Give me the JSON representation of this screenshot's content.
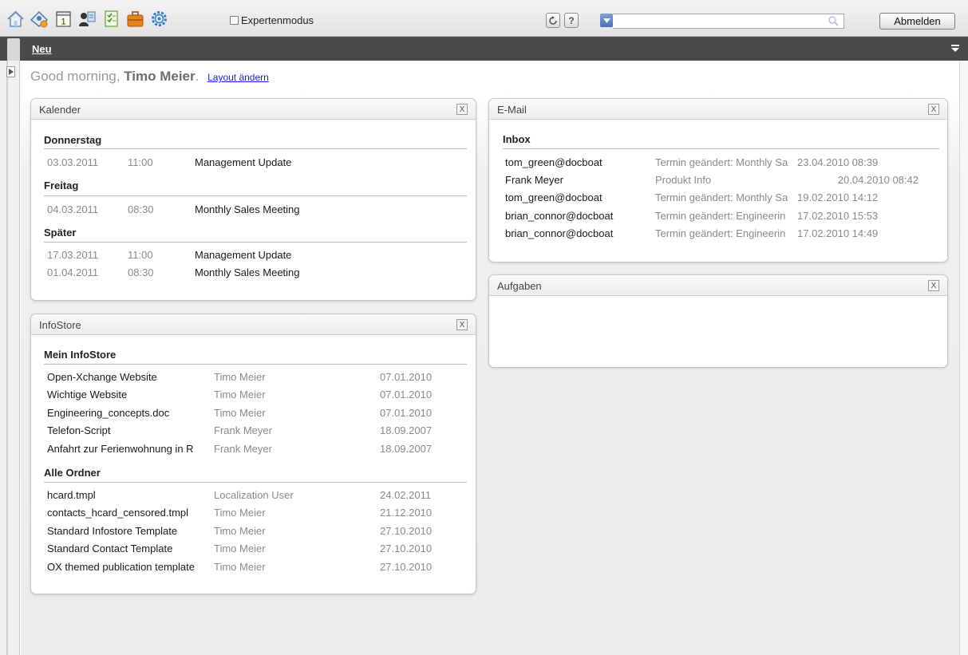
{
  "toolbar": {
    "icons": [
      "home-icon",
      "address-book-icon",
      "calendar-icon",
      "contacts-icon",
      "tasks-icon",
      "infostore-icon",
      "settings-icon"
    ],
    "calendar_day": "1",
    "expert_mode_label": "Expertenmodus",
    "refresh_icon": "refresh-icon",
    "help_label": "?",
    "search_placeholder": "",
    "logout_label": "Abmelden"
  },
  "subbar": {
    "new_label": "Neu"
  },
  "greeting": {
    "prefix": "Good morning, ",
    "name": "Timo Meier",
    "suffix": ".",
    "layout_link": "Layout ändern"
  },
  "calendar_widget": {
    "title": "Kalender",
    "close": "X",
    "groups": [
      {
        "day": "Donnerstag",
        "entries": [
          {
            "date": "03.03.2011",
            "time": "11:00",
            "title": "Management Update"
          }
        ]
      },
      {
        "day": "Freitag",
        "entries": [
          {
            "date": "04.03.2011",
            "time": "08:30",
            "title": "Monthly Sales Meeting"
          }
        ]
      },
      {
        "day": "Später",
        "entries": [
          {
            "date": "17.03.2011",
            "time": "11:00",
            "title": "Management Update"
          },
          {
            "date": "01.04.2011",
            "time": "08:30",
            "title": "Monthly Sales Meeting"
          }
        ]
      }
    ]
  },
  "infostore_widget": {
    "title": "InfoStore",
    "close": "X",
    "sections": [
      {
        "heading": "Mein InfoStore",
        "rows": [
          {
            "name": "Open-Xchange Website",
            "owner": "Timo Meier",
            "date": "07.01.2010"
          },
          {
            "name": "Wichtige Website",
            "owner": "Timo Meier",
            "date": "07.01.2010"
          },
          {
            "name": "Engineering_concepts.doc",
            "owner": "Timo Meier",
            "date": "07.01.2010"
          },
          {
            "name": "Telefon-Script",
            "owner": "Frank Meyer",
            "date": "18.09.2007"
          },
          {
            "name": "Anfahrt zur Ferienwohnung in R",
            "owner": "Frank Meyer",
            "date": "18.09.2007"
          }
        ]
      },
      {
        "heading": "Alle Ordner",
        "rows": [
          {
            "name": "hcard.tmpl",
            "owner": "Localization User",
            "date": "24.02.2011"
          },
          {
            "name": "contacts_hcard_censored.tmpl",
            "owner": "Timo Meier",
            "date": "21.12.2010"
          },
          {
            "name": "Standard Infostore Template",
            "owner": "Timo Meier",
            "date": "27.10.2010"
          },
          {
            "name": "Standard Contact Template",
            "owner": "Timo Meier",
            "date": "27.10.2010"
          },
          {
            "name": "OX themed publication template",
            "owner": "Timo Meier",
            "date": "27.10.2010"
          }
        ]
      }
    ]
  },
  "email_widget": {
    "title": "E-Mail",
    "close": "X",
    "folder": "Inbox",
    "rows": [
      {
        "from": "tom_green@docboat",
        "subject": "Termin geändert: Monthly Sa",
        "date": "23.04.2010 08:39"
      },
      {
        "from": "Frank Meyer",
        "subject": "Produkt Info",
        "date": "20.04.2010 08:42"
      },
      {
        "from": "tom_green@docboat",
        "subject": "Termin geändert: Monthly Sa",
        "date": "19.02.2010 14:12"
      },
      {
        "from": "brian_connor@docboat",
        "subject": "Termin geändert: Engineerin",
        "date": "17.02.2010 15:53"
      },
      {
        "from": "brian_connor@docboat",
        "subject": "Termin geändert: Engineerin",
        "date": "17.02.2010 14:49"
      }
    ]
  },
  "tasks_widget": {
    "title": "Aufgaben",
    "close": "X"
  }
}
